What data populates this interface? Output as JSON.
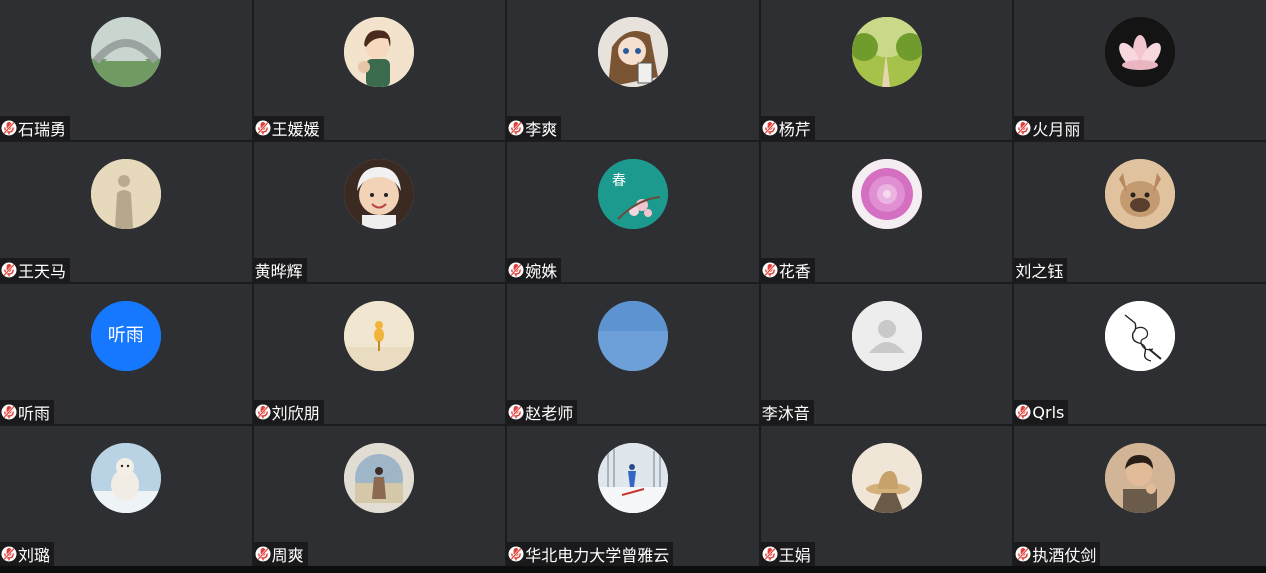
{
  "participants": [
    {
      "name": "石瑞勇",
      "muted": true,
      "avatar": "stone-bridge-photo",
      "bg": "#8ea89a"
    },
    {
      "name": "王媛媛",
      "muted": true,
      "avatar": "cartoon-girl-illustration",
      "bg": "#f1dcc2"
    },
    {
      "name": "李爽",
      "muted": true,
      "avatar": "anime-character",
      "bg": "#e9e4df"
    },
    {
      "name": "杨芹",
      "muted": true,
      "avatar": "green-trees-photo",
      "bg": "#b8c95a"
    },
    {
      "name": "火月丽",
      "muted": true,
      "avatar": "lotus-flower-photo",
      "bg": "#1e1c1c"
    },
    {
      "name": "王天马",
      "muted": true,
      "avatar": "shadow-photo",
      "bg": "#e6d8b8"
    },
    {
      "name": "黄晔辉",
      "muted": false,
      "avatar": "baby-photo",
      "bg": "#c9a88c"
    },
    {
      "name": "婉姝",
      "muted": true,
      "avatar": "spring-blossom-art",
      "bg": "#1f9a8f"
    },
    {
      "name": "花香",
      "muted": true,
      "avatar": "pink-dahlia-photo",
      "bg": "#c85fb8"
    },
    {
      "name": "刘之钰",
      "muted": false,
      "avatar": "french-bulldog-photo",
      "bg": "#d9b48c"
    },
    {
      "name": "听雨",
      "muted": true,
      "avatar": "text-avatar",
      "avatar_text": "听雨",
      "bg": "#1677ff"
    },
    {
      "name": "刘欣朋",
      "muted": true,
      "avatar": "duck-toy-photo",
      "bg": "#efe3c8"
    },
    {
      "name": "赵老师",
      "muted": true,
      "avatar": "blue-sky-photo",
      "bg": "#6f9fd6"
    },
    {
      "name": "李沐音",
      "muted": false,
      "avatar": "default-person-icon",
      "bg": "#ededed"
    },
    {
      "name": "Qrls",
      "muted": true,
      "avatar": "ink-sketch",
      "bg": "#ffffff"
    },
    {
      "name": "刘璐",
      "muted": true,
      "avatar": "polar-bear-photo",
      "bg": "#a9c6d8"
    },
    {
      "name": "周爽",
      "muted": true,
      "avatar": "girl-field-photo",
      "bg": "#d8d2c6"
    },
    {
      "name": "华北电力大学曾雅云",
      "muted": true,
      "avatar": "skier-snow-photo",
      "bg": "#dfe5ea"
    },
    {
      "name": "王娟",
      "muted": true,
      "avatar": "hat-silhouette-photo",
      "bg": "#e7dccd"
    },
    {
      "name": "执酒仗剑",
      "muted": true,
      "avatar": "man-portrait-photo",
      "bg": "#c9a78a"
    }
  ],
  "colors": {
    "tile": "#2e2f32",
    "mic_muted": "#e0403a",
    "label_text": "#ffffff"
  }
}
